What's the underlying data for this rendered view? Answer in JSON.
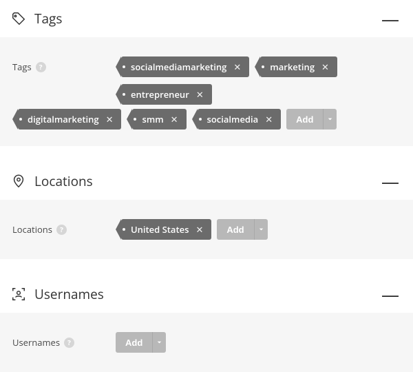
{
  "sections": {
    "tags": {
      "title": "Tags",
      "collapse_glyph": "—",
      "help_glyph": "?",
      "field_label": "Tags",
      "chips": [
        "socialmediamarketing",
        "marketing",
        "entrepreneur",
        "digitalmarketing",
        "smm",
        "socialmedia"
      ],
      "add_label": "Add"
    },
    "locations": {
      "title": "Locations",
      "collapse_glyph": "—",
      "help_glyph": "?",
      "field_label": "Locations",
      "chips": [
        "United States"
      ],
      "add_label": "Add"
    },
    "usernames": {
      "title": "Usernames",
      "collapse_glyph": "—",
      "help_glyph": "?",
      "field_label": "Usernames",
      "chips": [],
      "add_label": "Add"
    }
  },
  "colors": {
    "chip_bg": "#6b6b6b",
    "add_bg": "#b8b8b8",
    "body_bg": "#f6f6f6"
  }
}
